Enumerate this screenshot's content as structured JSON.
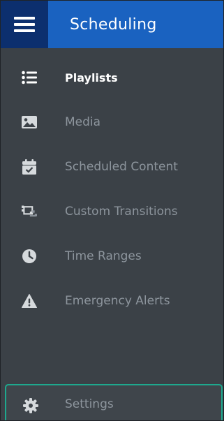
{
  "header": {
    "menu_icon": "hamburger-menu-icon",
    "title": "Scheduling"
  },
  "nav": {
    "items": [
      {
        "label": "Playlists",
        "icon": "list-icon",
        "active": true
      },
      {
        "label": "Media",
        "icon": "image-icon",
        "active": false
      },
      {
        "label": "Scheduled Content",
        "icon": "calendar-check-icon",
        "active": false
      },
      {
        "label": "Custom Transitions",
        "icon": "transition-icon",
        "active": false
      },
      {
        "label": "Time Ranges",
        "icon": "clock-icon",
        "active": false
      },
      {
        "label": "Emergency Alerts",
        "icon": "warning-triangle-icon",
        "active": false
      }
    ]
  },
  "footer": {
    "settings_label": "Settings",
    "settings_icon": "gear-icon"
  },
  "colors": {
    "sidebar_bg": "#3b4147",
    "header_menu_bg": "#0c2f6e",
    "header_title_bg": "#1a62c0",
    "active_text": "#ffffff",
    "inactive_text": "#8d959d",
    "focus_border": "#1ea88e"
  }
}
